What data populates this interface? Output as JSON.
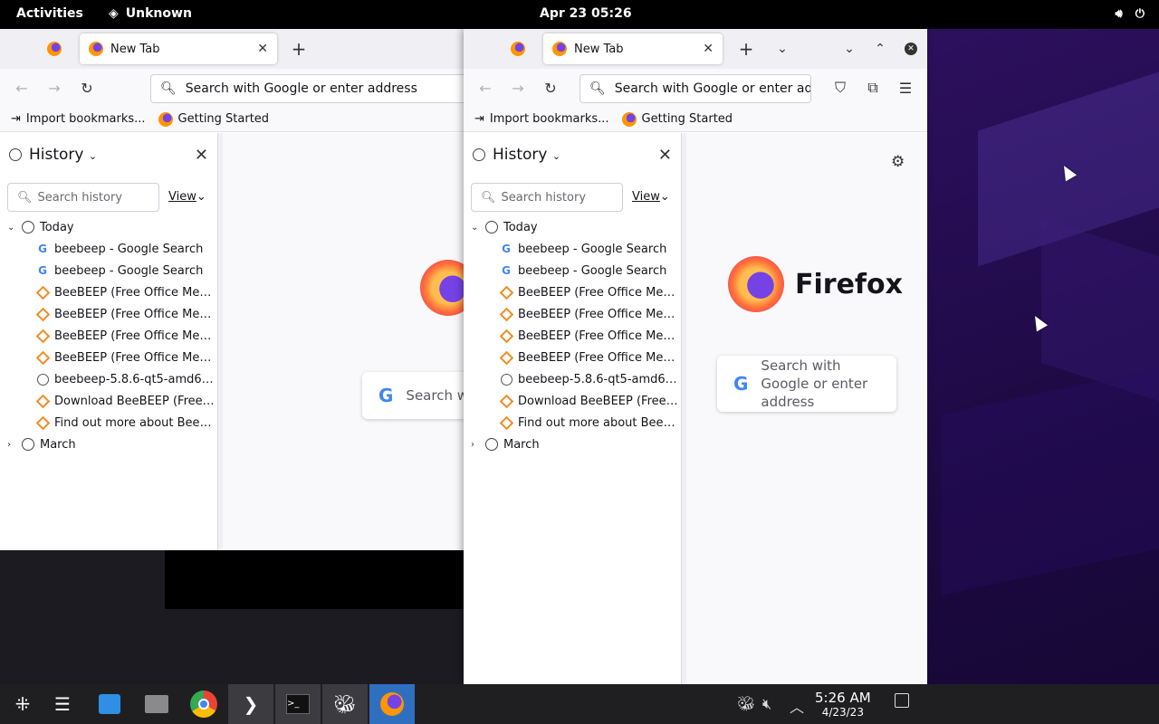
{
  "topbar": {
    "activities": "Activities",
    "app_name": "Unknown",
    "clock": "Apr 23  05:26",
    "volume_icon": "speaker-icon",
    "power_icon": "power-icon"
  },
  "windows": [
    {
      "id": "left",
      "tab_title": "New Tab",
      "url_placeholder": "Search with Google or enter address",
      "bookmarks": [
        "Import bookmarks...",
        "Getting Started"
      ],
      "sidebar": {
        "title": "History",
        "search_placeholder": "Search history",
        "view_label": "View",
        "groups": [
          {
            "label": "Today",
            "items": [
              {
                "label": "beebeep - Google Search",
                "icon": "google-icon"
              },
              {
                "label": "beebeep - Google Search",
                "icon": "google-icon"
              },
              {
                "label": "BeeBEEP (Free Office Mess...",
                "icon": "beebeep-icon"
              },
              {
                "label": "BeeBEEP (Free Office Mess...",
                "icon": "beebeep-icon"
              },
              {
                "label": "BeeBEEP (Free Office Mess...",
                "icon": "beebeep-icon"
              },
              {
                "label": "BeeBEEP (Free Office Mess...",
                "icon": "beebeep-icon"
              },
              {
                "label": "beebeep-5.8.6-qt5-amd64....",
                "icon": "globe-icon"
              },
              {
                "label": "Download BeeBEEP (Free ...",
                "icon": "beebeep-icon"
              },
              {
                "label": "Find out more about BeeB...",
                "icon": "beebeep-icon"
              }
            ]
          },
          {
            "label": "March",
            "items": []
          }
        ]
      },
      "content": {
        "search_text": "Search w"
      }
    },
    {
      "id": "right",
      "tab_title": "New Tab",
      "url_placeholder": "Search with Google or enter address",
      "bookmarks": [
        "Import bookmarks...",
        "Getting Started"
      ],
      "sidebar": {
        "title": "History",
        "search_placeholder": "Search history",
        "view_label": "View",
        "groups": [
          {
            "label": "Today",
            "items": [
              {
                "label": "beebeep - Google Search",
                "icon": "google-icon"
              },
              {
                "label": "beebeep - Google Search",
                "icon": "google-icon"
              },
              {
                "label": "BeeBEEP (Free Office Mess...",
                "icon": "beebeep-icon"
              },
              {
                "label": "BeeBEEP (Free Office Mess...",
                "icon": "beebeep-icon"
              },
              {
                "label": "BeeBEEP (Free Office Mess...",
                "icon": "beebeep-icon"
              },
              {
                "label": "BeeBEEP (Free Office Mess...",
                "icon": "beebeep-icon"
              },
              {
                "label": "beebeep-5.8.6-qt5-amd64....",
                "icon": "globe-icon"
              },
              {
                "label": "Download BeeBEEP (Free ...",
                "icon": "beebeep-icon"
              },
              {
                "label": "Find out more about BeeB...",
                "icon": "beebeep-icon"
              }
            ]
          },
          {
            "label": "March",
            "items": []
          }
        ]
      },
      "content": {
        "brand": "Firefox",
        "search_text": "Search with Google or enter address"
      }
    }
  ],
  "taskbar": {
    "time": "5:26 AM",
    "date": "4/23/23",
    "apps": [
      "app-launcher-icon",
      "settings-icon",
      "software-store-icon",
      "files-icon",
      "chrome-icon",
      "terminal-icon",
      "console-icon",
      "beebeep-icon",
      "firefox-icon"
    ]
  }
}
